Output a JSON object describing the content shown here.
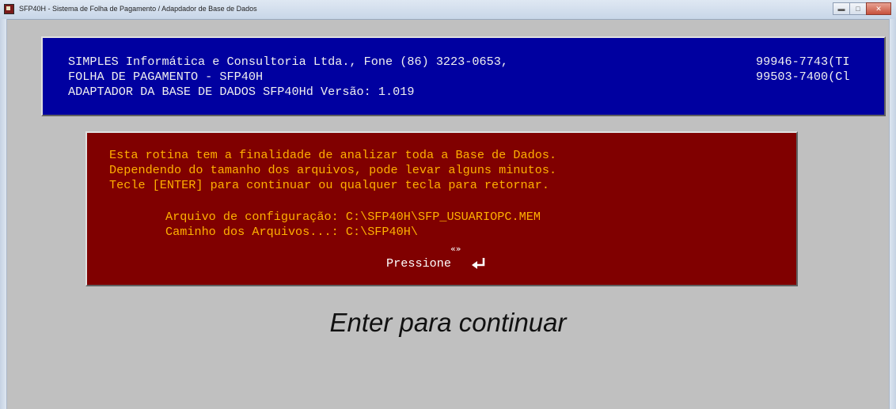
{
  "window": {
    "title": "SFP40H - Sistema de Folha de Pagamento / Adapdador de Base de Dados",
    "controls": [
      "minimize",
      "maximize",
      "close"
    ]
  },
  "header": {
    "line1": "SIMPLES Informática e Consultoria Ltda., Fone (86) 3223-0653,",
    "line1_phone": "99946-7743(TI",
    "line2": "FOLHA DE PAGAMENTO - SFP40H",
    "line2_phone": "99503-7400(Cl",
    "line3": "ADAPTADOR DA BASE DE DADOS SFP40Hd Versão: 1.019"
  },
  "message": {
    "line1": "Esta rotina tem a finalidade de analizar toda a Base de Dados.",
    "line2": "Dependendo do tamanho dos arquivos, pode levar alguns minutos.",
    "line3": "Tecle [ENTER] para continuar ou qualquer tecla para retornar.",
    "config_label": "Arquivo de configuração: C:\\SFP40H\\SFP_USUARIOPC.MEM",
    "path_label": "Caminho dos Arquivos...: C:\\SFP40H\\",
    "nav_arrows": "«»",
    "press_label": "Pressione"
  },
  "caption": "Enter para continuar",
  "icons": {
    "app": "app-icon",
    "enter": "enter-key-icon"
  },
  "colors": {
    "header_bg": "#0000a0",
    "header_text": "#f0f0f0",
    "message_bg": "#800000",
    "message_text": "#ffb000",
    "press_text": "#ffffff",
    "client_bg": "#c0c0c0"
  }
}
